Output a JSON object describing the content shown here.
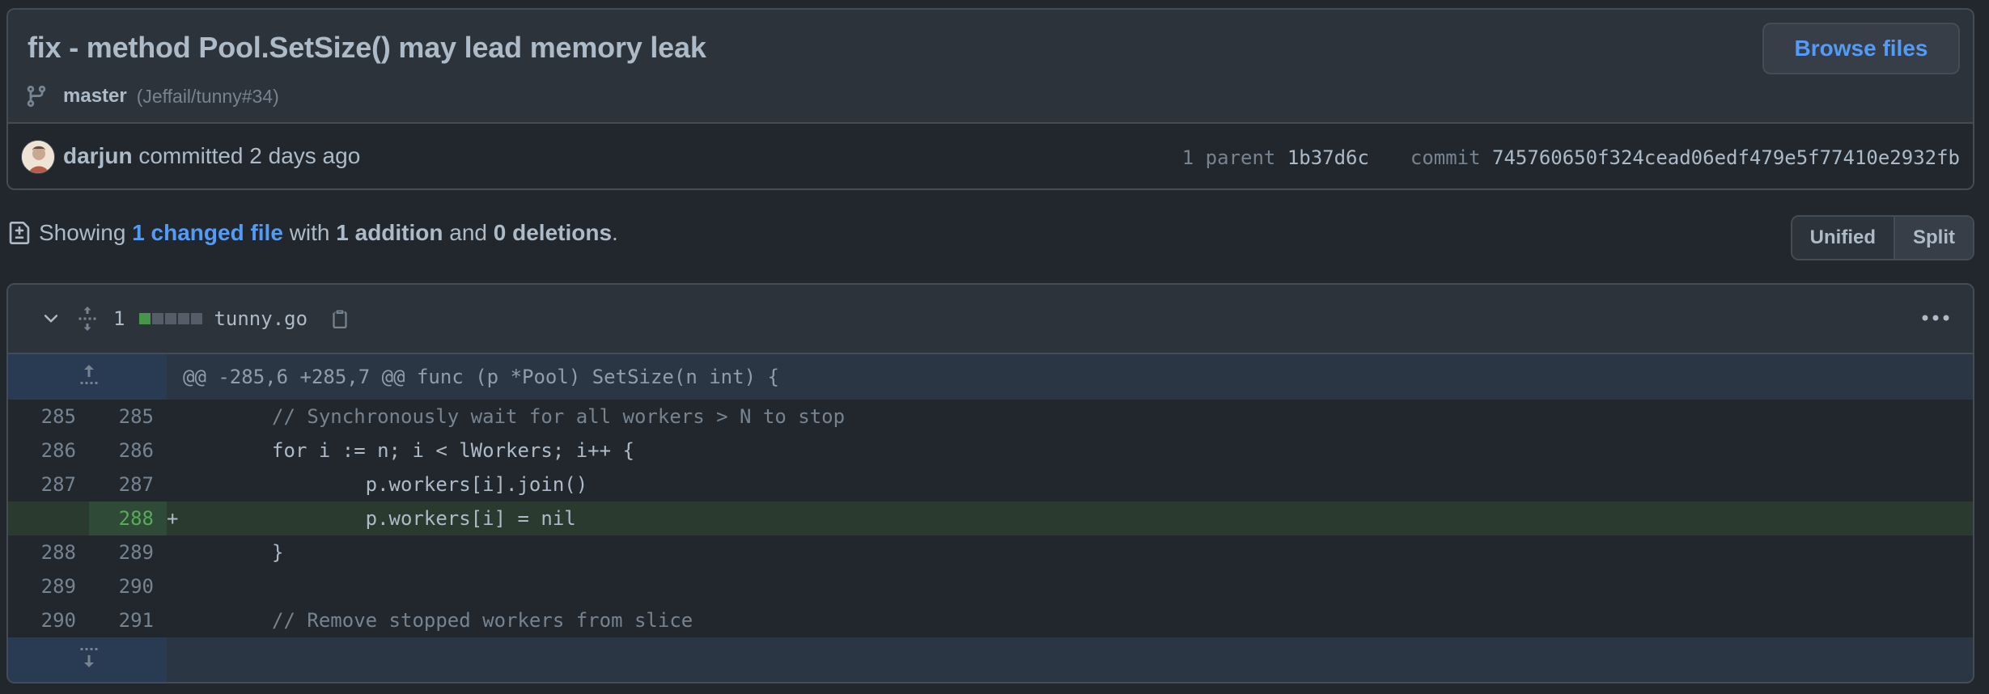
{
  "commit": {
    "title": "fix - method Pool.SetSize() may lead memory leak",
    "browse_files_label": "Browse files",
    "branch": "master",
    "ref": "(Jeffail/tunny#34)",
    "author": "darjun",
    "committed_text": "committed",
    "time": "2 days ago",
    "parent_label": "1 parent",
    "parent_sha": "1b37d6c",
    "commit_label": "commit",
    "commit_sha": "745760650f324cead06edf479e5f77410e2932fb"
  },
  "summary": {
    "showing": "Showing",
    "changed_files": "1 changed file",
    "with": "with",
    "additions": "1 addition",
    "and": "and",
    "deletions": "0 deletions",
    "period": "."
  },
  "view_toggle": {
    "unified": "Unified",
    "split": "Split"
  },
  "file": {
    "change_count": "1",
    "name": "tunny.go",
    "hunk_header": "@@ -285,6 +285,7 @@ func (p *Pool) SetSize(n int) {",
    "lines": [
      {
        "old": "285",
        "new": "285",
        "marker": " ",
        "code": "        // Synchronously wait for all workers > N to stop"
      },
      {
        "old": "286",
        "new": "286",
        "marker": " ",
        "code": "        for i := n; i < lWorkers; i++ {"
      },
      {
        "old": "287",
        "new": "287",
        "marker": " ",
        "code": "                p.workers[i].join()"
      },
      {
        "old": "",
        "new": "288",
        "marker": "+",
        "code": "                p.workers[i] = nil"
      },
      {
        "old": "288",
        "new": "289",
        "marker": " ",
        "code": "        }"
      },
      {
        "old": "289",
        "new": "290",
        "marker": " ",
        "code": ""
      },
      {
        "old": "290",
        "new": "291",
        "marker": " ",
        "code": "        // Remove stopped workers from slice"
      }
    ]
  },
  "colors": {
    "background": "#22272e",
    "link": "#539bf5",
    "addition": "#46954a"
  }
}
